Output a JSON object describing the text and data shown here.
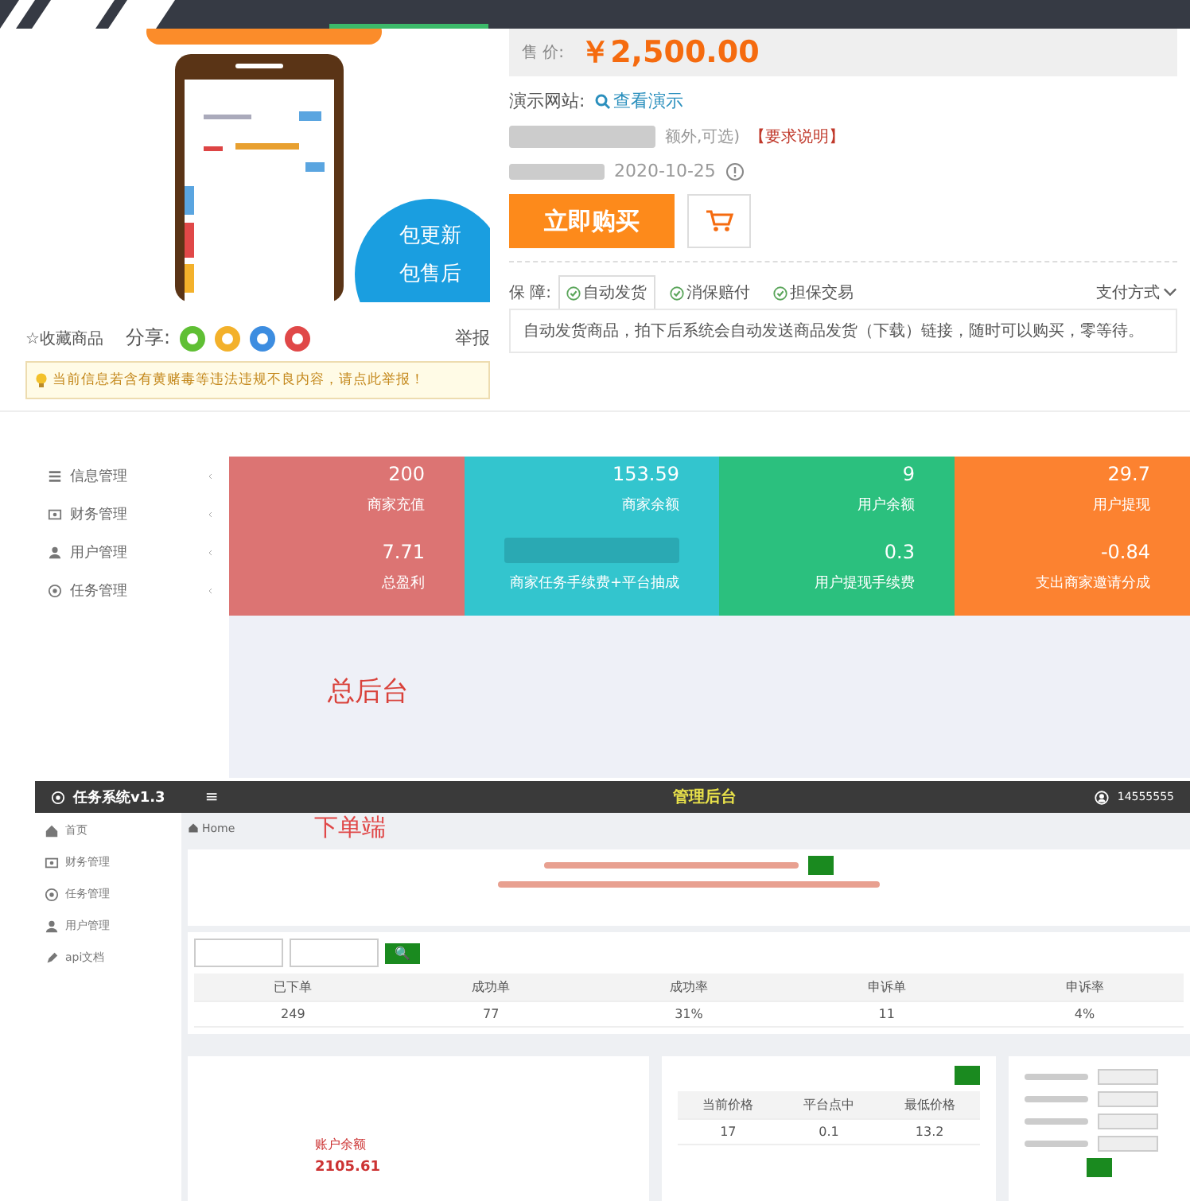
{
  "product": {
    "phone_badge": [
      "包更新",
      "包售后"
    ],
    "favorite": "☆收藏商品",
    "share_label": "分享:",
    "report": "举报",
    "notice": "当前信息若含有黄赌毒等违法违规不良内容，请点此举报！",
    "price_label": "售 价:",
    "price": "￥2,500.00",
    "demo_label": "演示网站:",
    "demo_link": "查看演示",
    "extra_note": "额外,可选)",
    "requirement_link": "【要求说明】",
    "updated": "2020-10-25",
    "buy_button": "立即购买",
    "guarantee_label": "保 障:",
    "guarantees": [
      {
        "label": "自动发货",
        "selected": true
      },
      {
        "label": "消保赔付",
        "selected": false
      },
      {
        "label": "担保交易",
        "selected": false
      }
    ],
    "payment": "支付方式",
    "delivery_text": "自动发货商品，拍下后系统会自动发送商品发货（下载）链接，随时可以购买，零等待。"
  },
  "admin": {
    "menu": [
      "信息管理",
      "财务管理",
      "用户管理",
      "任务管理"
    ],
    "tiles": [
      {
        "color": "#dc7473",
        "value": "200",
        "label": "商家充值",
        "value2": "7.71",
        "label2": "总盈利"
      },
      {
        "color": "#33c5ce",
        "value": "153.59",
        "label": "商家余额",
        "label2": "商家任务手续费+平台抽成"
      },
      {
        "color": "#2bc07e",
        "value": "9",
        "label": "用户余额",
        "value2": "0.3",
        "label2": "用户提现手续费"
      },
      {
        "color": "#fc8230",
        "value": "29.7",
        "label": "用户提现",
        "value2": "-0.84",
        "label2": "支出商家邀请分成"
      }
    ],
    "caption": "总后台"
  },
  "client": {
    "logo": "任务系统v1.3",
    "menu_button": "≡",
    "title": "管理后台",
    "user": "14555555",
    "menu": [
      "首页",
      "财务管理",
      "任务管理",
      "用户管理",
      "api文档"
    ],
    "breadcrumb": "Home",
    "caption": "下单端",
    "search_button": "🔍",
    "stats": {
      "columns": [
        "已下单",
        "成功单",
        "成功率",
        "申诉单",
        "申诉率"
      ],
      "values": [
        "249",
        "77",
        "31%",
        "11",
        "4%"
      ]
    },
    "balance_label": "账户余额",
    "balance": "2105.61",
    "prices": {
      "columns": [
        "当前价格",
        "平台点中",
        "最低价格"
      ],
      "values": [
        "17",
        "0.1",
        "13.2"
      ]
    }
  }
}
